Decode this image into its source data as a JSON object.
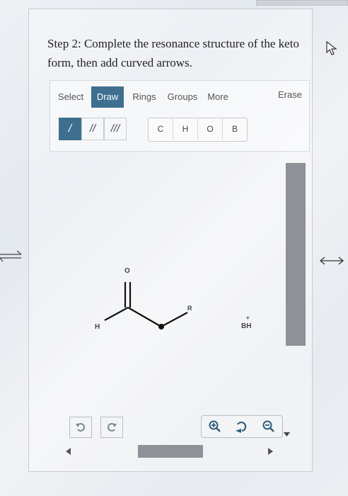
{
  "instruction": "Step 2: Complete the resonance structure of the keto form, then add curved arrows.",
  "toolbar": {
    "tabs": [
      {
        "label": "Select",
        "active": false
      },
      {
        "label": "Draw",
        "active": true
      },
      {
        "label": "Rings",
        "active": false
      },
      {
        "label": "Groups",
        "active": false
      },
      {
        "label": "More",
        "active": false
      }
    ],
    "erase_label": "Erase",
    "bonds": [
      {
        "symbol": "/",
        "name": "single-bond",
        "active": true
      },
      {
        "symbol": "//",
        "name": "double-bond",
        "active": false
      },
      {
        "symbol": "///",
        "name": "triple-bond",
        "active": false
      }
    ],
    "atoms": [
      "C",
      "H",
      "O",
      "B"
    ]
  },
  "molecule": {
    "labels": {
      "oxygen": "O",
      "hydrogen": "H",
      "r_group": "R",
      "base": "BH",
      "charge": "+"
    }
  },
  "controls": {
    "undo_icon": "undo-icon",
    "redo_icon": "redo-icon",
    "zoom_in_icon": "zoom-in-icon",
    "reset_zoom_icon": "reset-zoom-icon",
    "zoom_out_icon": "zoom-out-icon"
  },
  "colors": {
    "accent": "#3f6f8f",
    "scroll_thumb": "#8e9197"
  }
}
